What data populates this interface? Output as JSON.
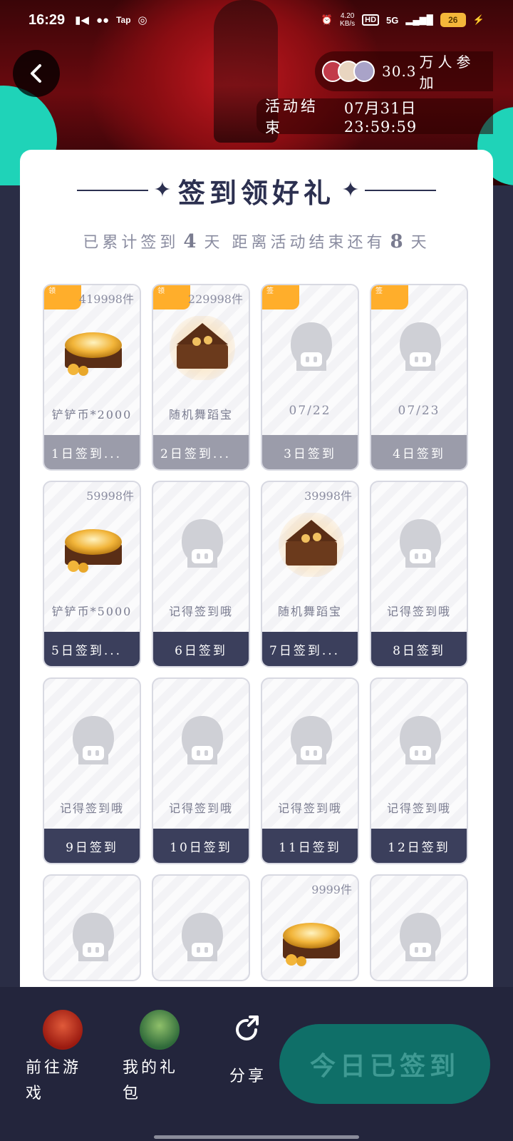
{
  "status_bar": {
    "time": "16:29",
    "icons": [
      "video-icon",
      "wechat-icon",
      "taptap-icon",
      "swirl-icon"
    ],
    "net_speed": "4.20\nKB/s",
    "network": "5G",
    "battery": "26"
  },
  "header": {
    "participants_count": "30.3",
    "participants_label": "万人参加",
    "end_label": "活动结束",
    "end_time": "07月31日 23:59:59"
  },
  "card": {
    "title": "签到领好礼",
    "progress_prefix": "已累计签到",
    "checked_days": "4",
    "progress_mid": "天  距离活动结束还有",
    "remaining_days": "8",
    "progress_suffix": "天"
  },
  "tiles": [
    {
      "badge": "领",
      "stock": "419998件",
      "image": "coin-chest",
      "label": "铲铲币*2000",
      "footer": "1日签到...",
      "state": "past"
    },
    {
      "badge": "领",
      "stock": "229998件",
      "image": "dance-chest",
      "label": "随机舞蹈宝",
      "footer": "2日签到...",
      "state": "past"
    },
    {
      "badge": "签",
      "stock": "",
      "image": "placeholder",
      "label": "07/22",
      "footer": "3日签到",
      "state": "past"
    },
    {
      "badge": "签",
      "stock": "",
      "image": "placeholder",
      "label": "07/23",
      "footer": "4日签到",
      "state": "past"
    },
    {
      "badge": "",
      "stock": "59998件",
      "image": "coin-chest",
      "label": "铲铲币*5000",
      "footer": "5日签到...",
      "state": "dark"
    },
    {
      "badge": "",
      "stock": "",
      "image": "placeholder",
      "label": "记得签到哦",
      "footer": "6日签到",
      "state": "dark"
    },
    {
      "badge": "",
      "stock": "39998件",
      "image": "dance-chest",
      "label": "随机舞蹈宝",
      "footer": "7日签到...",
      "state": "dark"
    },
    {
      "badge": "",
      "stock": "",
      "image": "placeholder",
      "label": "记得签到哦",
      "footer": "8日签到",
      "state": "dark"
    },
    {
      "badge": "",
      "stock": "",
      "image": "placeholder",
      "label": "记得签到哦",
      "footer": "9日签到",
      "state": "dark"
    },
    {
      "badge": "",
      "stock": "",
      "image": "placeholder",
      "label": "记得签到哦",
      "footer": "10日签到",
      "state": "dark"
    },
    {
      "badge": "",
      "stock": "",
      "image": "placeholder",
      "label": "记得签到哦",
      "footer": "11日签到",
      "state": "dark"
    },
    {
      "badge": "",
      "stock": "",
      "image": "placeholder",
      "label": "记得签到哦",
      "footer": "12日签到",
      "state": "dark"
    },
    {
      "badge": "",
      "stock": "",
      "image": "placeholder",
      "label": "",
      "footer": "",
      "state": "partial"
    },
    {
      "badge": "",
      "stock": "",
      "image": "placeholder",
      "label": "",
      "footer": "",
      "state": "partial"
    },
    {
      "badge": "",
      "stock": "9999件",
      "image": "coin-chest",
      "label": "",
      "footer": "",
      "state": "partial"
    },
    {
      "badge": "",
      "stock": "",
      "image": "placeholder",
      "label": "",
      "footer": "",
      "state": "partial"
    }
  ],
  "bottom_bar": {
    "play_label": "前往游戏",
    "gift_label": "我的礼包",
    "share_label": "分享",
    "cta_label": "今日已签到"
  },
  "colors": {
    "accent_teal": "#1fd3b8",
    "badge_orange": "#ffae2b",
    "dark_footer": "#3b3f5c",
    "cta_bg": "#0f6f68"
  }
}
